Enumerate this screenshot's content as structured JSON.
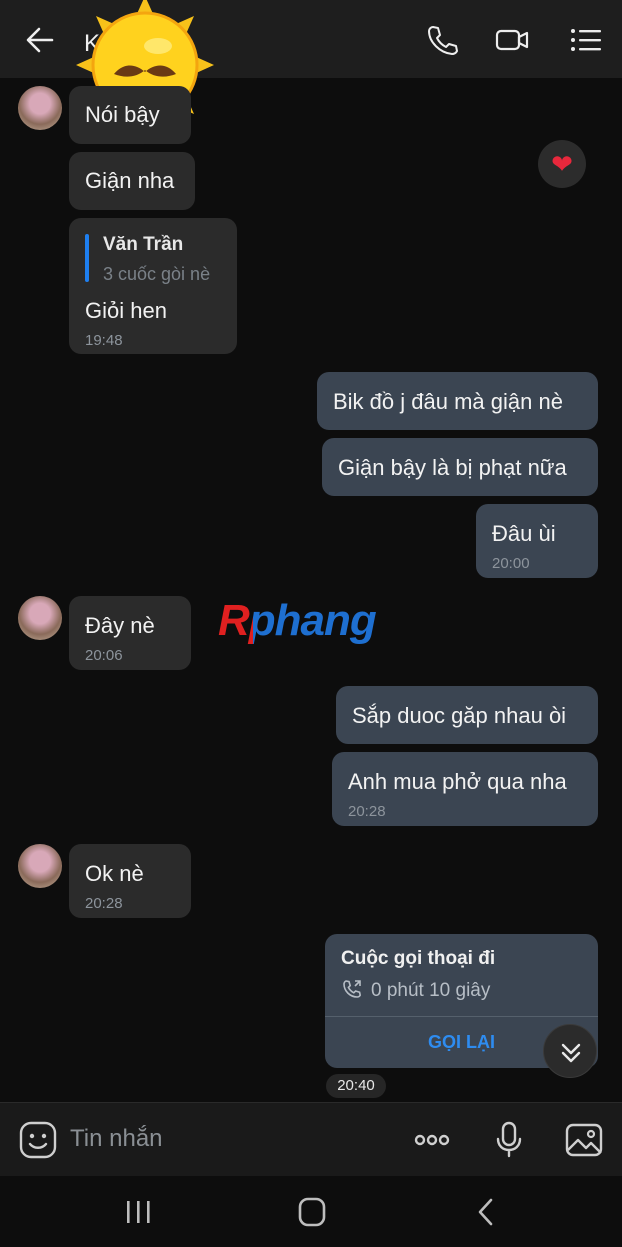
{
  "header": {
    "title": "K",
    "back_icon": "arrow-left-icon",
    "call_icon": "phone-icon",
    "video_icon": "video-icon",
    "menu_icon": "list-menu-icon"
  },
  "messages": [
    {
      "dir": "in",
      "text": "Nói bậy"
    },
    {
      "dir": "in",
      "text": "Giận nha"
    },
    {
      "dir": "in",
      "reply_name": "Văn Trần",
      "reply_sub": "3 cuốc gòi nè",
      "text": "Giỏi hen",
      "time": "19:48"
    },
    {
      "dir": "out",
      "text": "Bik đồ j đâu mà giận nè"
    },
    {
      "dir": "out",
      "text": "Giận bậy là bị phạt nữa"
    },
    {
      "dir": "out",
      "text": "Đâu ùi",
      "time": "20:00"
    },
    {
      "dir": "in",
      "text": "Đây nè",
      "time": "20:06"
    },
    {
      "dir": "out",
      "text": "Sắp duoc găp nhau òi"
    },
    {
      "dir": "out",
      "text": "Anh mua phở qua nha",
      "time": "20:28"
    },
    {
      "dir": "in",
      "text": "Ok nè",
      "time": "20:28"
    }
  ],
  "reaction": "❤",
  "watermark": "Rphang",
  "call_card": {
    "title": "Cuộc gọi thoại đi",
    "duration": "0 phút 10 giây",
    "action": "GỌI LẠI"
  },
  "time_chip": "20:40",
  "composer": {
    "placeholder": "Tin nhắn"
  },
  "colors": {
    "background": "#0d0d0d",
    "incoming_bubble": "#2b2b2b",
    "outgoing_bubble": "#3b4552",
    "accent": "#2e8cf0"
  }
}
